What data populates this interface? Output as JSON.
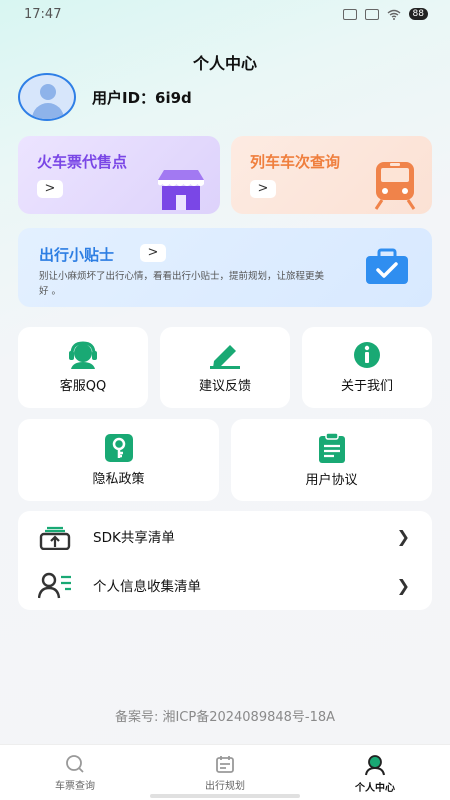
{
  "status_bar": {
    "time": "17:47",
    "battery": "88"
  },
  "header": {
    "title": "个人中心"
  },
  "profile": {
    "user_id_label": "用户ID：6i9d"
  },
  "promos": {
    "ticket_agency": {
      "title": "火车票代售点",
      "arrow": ">"
    },
    "train_query": {
      "title": "列车车次查询",
      "arrow": ">"
    }
  },
  "tips": {
    "title": "出行小贴士",
    "arrow": ">",
    "description": "别让小麻烦坏了出行心情，看看出行小贴士，提前规划，让旅程更美好 。"
  },
  "grid": {
    "qq": "客服QQ",
    "feedback": "建议反馈",
    "about": "关于我们",
    "privacy": "隐私政策",
    "agreement": "用户协议"
  },
  "list": [
    {
      "label": "SDK共享清单",
      "icon": "share-box-icon"
    },
    {
      "label": "个人信息收集清单",
      "icon": "user-list-icon"
    }
  ],
  "footer": {
    "icp": "备案号: 湘ICP备2024089848号-18A"
  },
  "tabs": [
    {
      "label": "车票查询",
      "icon": "search-icon"
    },
    {
      "label": "出行规划",
      "icon": "calendar-icon"
    },
    {
      "label": "个人中心",
      "icon": "person-icon",
      "active": true
    }
  ],
  "colors": {
    "accent_green": "#19a974",
    "purple": "#7a47e6",
    "orange": "#ef7f3e",
    "blue": "#2d7ee3"
  }
}
